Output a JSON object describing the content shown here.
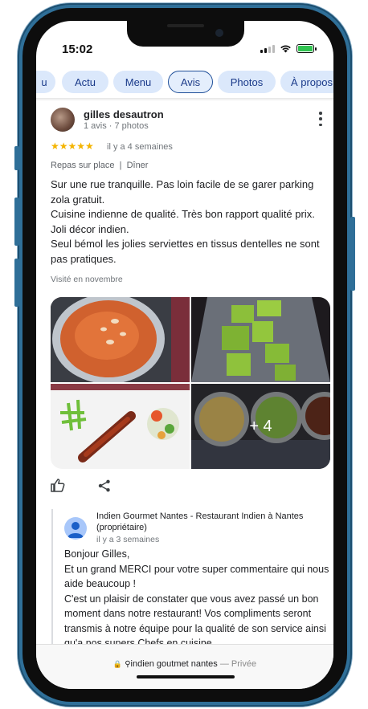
{
  "status_bar": {
    "time": "15:02",
    "icons": [
      "signal-icon",
      "wifi-icon",
      "battery-charging-icon"
    ]
  },
  "tabs": [
    {
      "label": "u",
      "active": false
    },
    {
      "label": "Actu",
      "active": false
    },
    {
      "label": "Menu",
      "active": false
    },
    {
      "label": "Avis",
      "active": true
    },
    {
      "label": "Photos",
      "active": false
    },
    {
      "label": "À propos",
      "active": false
    }
  ],
  "review": {
    "author": "gilles desautron",
    "author_meta": "1 avis · 7 photos",
    "stars": "★★★★★",
    "rating": 5,
    "date": "il y a 4 semaines",
    "meal_tags": "Repas sur place  |  Dîner",
    "text_lines": [
      "Sur une rue tranquille. Pas loin facile de se garer parking zola gratuit.",
      "Cuisine indienne de qualité. Très bon rapport qualité prix.",
      "Joli décor indien.",
      "Seul bémol les jolies serviettes en tissus dentelles ne sont pas pratiques."
    ],
    "visit": "Visité en novembre",
    "more_photos": "+ 4"
  },
  "owner_reply": {
    "name": "Indien Gourmet Nantes - Restaurant Indien à Nantes (propriétaire)",
    "date": "il y a 3 semaines",
    "text_lines": [
      "Bonjour Gilles,",
      "Et un grand MERCI pour votre super commentaire qui nous aide beaucoup !",
      "C'est un plaisir de constater que vous avez passé un bon moment dans notre restaurant! Vos compliments seront transmis à notre équipe pour la qualité de son service ainsi qu'a nos supers Chefs en cuisine."
    ]
  },
  "url_bar": {
    "query": "indien goutmet nantes",
    "mode": "— Privée"
  },
  "colors": {
    "tab_bg": "#dbe8fb",
    "tab_active_border": "#1f4f99",
    "star": "#f4b400",
    "phone_frame": "#2f6f98"
  }
}
